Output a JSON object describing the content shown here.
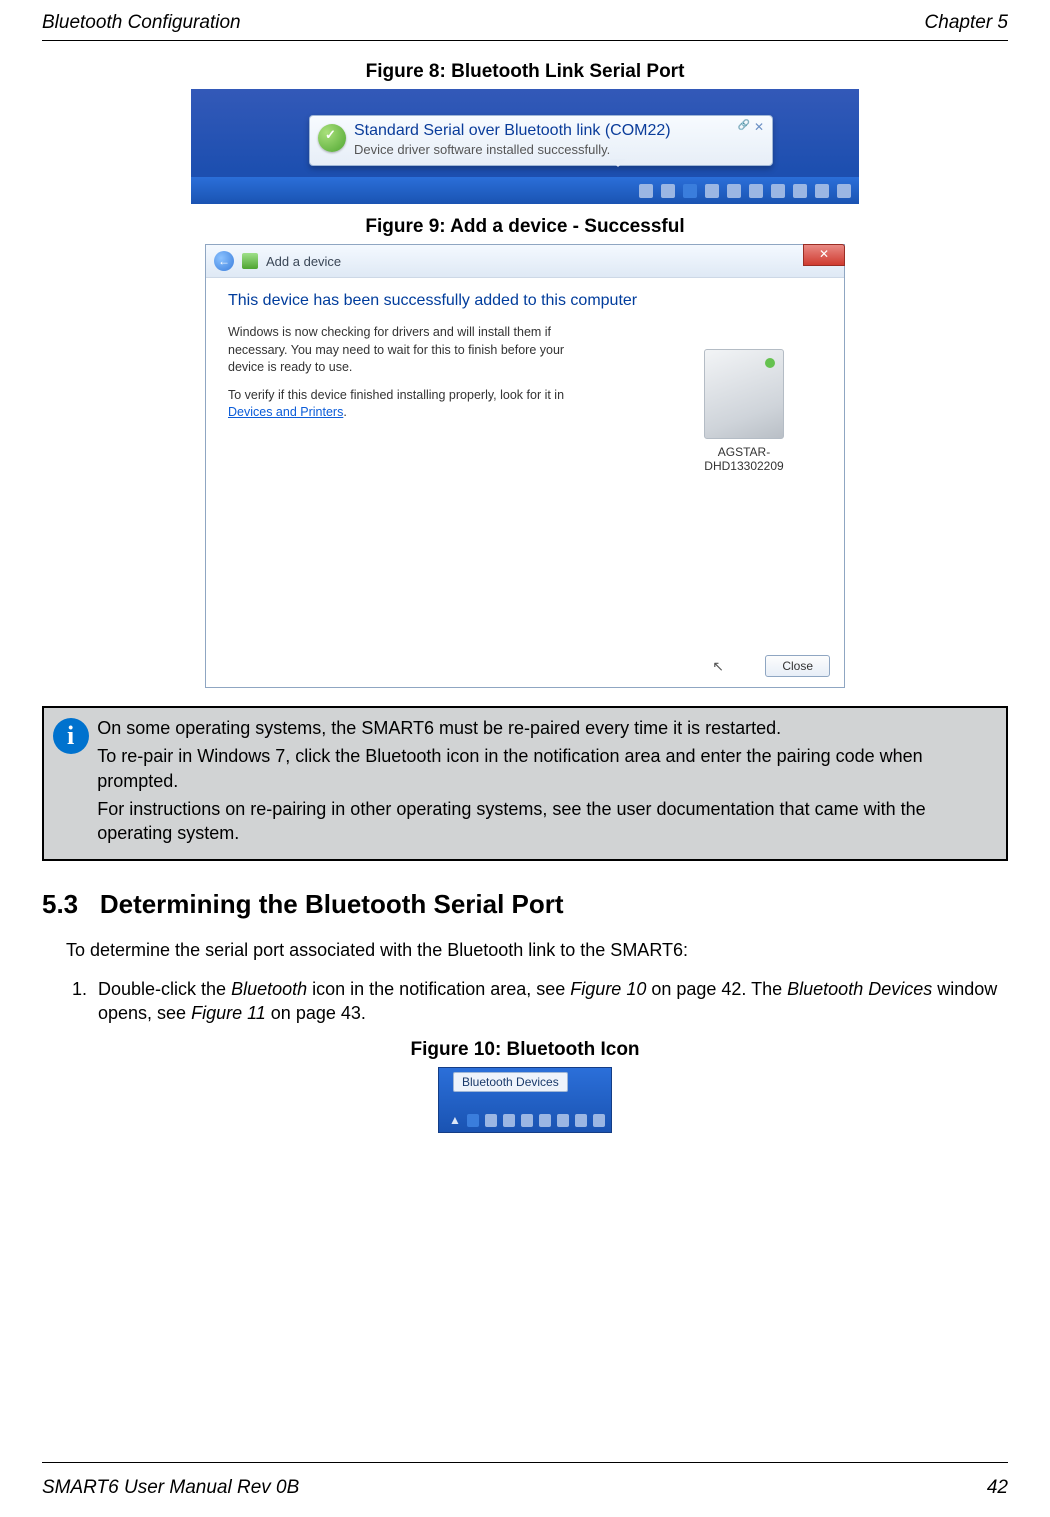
{
  "header": {
    "left": "Bluetooth Configuration",
    "right": "Chapter 5"
  },
  "footer": {
    "left": "SMART6 User Manual Rev 0B",
    "right": "42"
  },
  "figure8": {
    "caption": "Figure 8: Bluetooth Link Serial Port",
    "balloon_title": "Standard Serial over Bluetooth link (COM22)",
    "balloon_text": "Device driver software installed successfully."
  },
  "figure9": {
    "caption": "Figure 9: Add a device - Successful",
    "window_title": "Add a device",
    "heading": "This device has been successfully added to this computer",
    "para1_a": "Windows is now checking for drivers and will install them if necessary. You may need to wait for this to finish before your device is ready to use.",
    "para2_a": "To verify if this device finished installing properly, look for it in ",
    "para2_link": "Devices and Printers",
    "para2_b": ".",
    "device_name": "AGSTAR-DHD13302209",
    "close_label": "Close"
  },
  "infobox": {
    "p1": "On some operating systems, the SMART6 must be re-paired every time it is restarted.",
    "p2": "To re-pair in Windows 7, click the Bluetooth icon in the notification area and enter the pairing code when prompted.",
    "p3": "For instructions on re-pairing in other operating systems, see the user documentation that came with the operating system."
  },
  "section": {
    "number": "5.3",
    "title": "Determining the Bluetooth Serial Port",
    "intro": "To determine the serial port associated with the Bluetooth link to the SMART6:",
    "step1_a": "Double-click the ",
    "step1_em1": "Bluetooth",
    "step1_b": " icon in the notification area, see ",
    "step1_em2": "Figure 10",
    "step1_c": " on page 42. The ",
    "step1_em3": "Bluetooth Devices",
    "step1_d": " window opens, see ",
    "step1_em4": "Figure 11",
    "step1_e": " on page 43."
  },
  "figure10": {
    "caption": "Figure 10: Bluetooth Icon",
    "tooltip": "Bluetooth Devices"
  }
}
